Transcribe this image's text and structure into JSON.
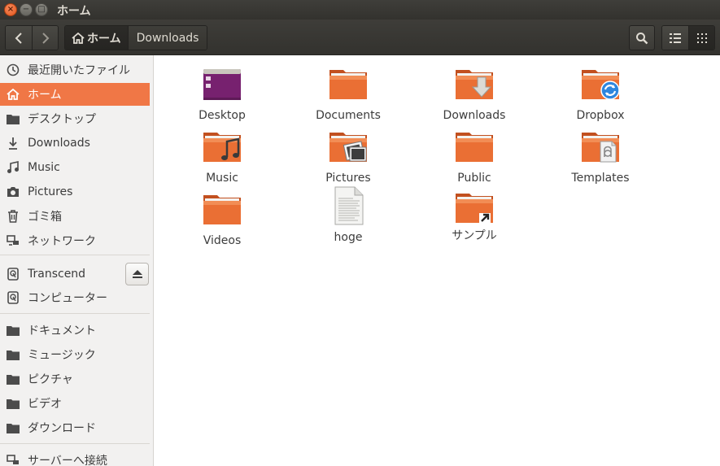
{
  "window": {
    "title": "ホーム"
  },
  "toolbar": {
    "breadcrumbs": [
      {
        "label": "ホーム",
        "active": true
      },
      {
        "label": "Downloads",
        "active": false
      }
    ]
  },
  "sidebar": {
    "items": [
      {
        "label": "最近開いたファイル",
        "icon": "clock-icon"
      },
      {
        "label": "ホーム",
        "icon": "home-icon",
        "active": true
      },
      {
        "label": "デスクトップ",
        "icon": "folder-icon"
      },
      {
        "label": "Downloads",
        "icon": "download-icon"
      },
      {
        "label": "Music",
        "icon": "music-icon"
      },
      {
        "label": "Pictures",
        "icon": "camera-icon"
      },
      {
        "label": "ゴミ箱",
        "icon": "trash-icon"
      },
      {
        "label": "ネットワーク",
        "icon": "network-icon"
      },
      {
        "label": "Transcend",
        "icon": "drive-icon"
      },
      {
        "label": "コンピューター",
        "icon": "drive-icon"
      },
      {
        "label": "ドキュメント",
        "icon": "folder-icon"
      },
      {
        "label": "ミュージック",
        "icon": "folder-icon"
      },
      {
        "label": "ピクチャ",
        "icon": "folder-icon"
      },
      {
        "label": "ビデオ",
        "icon": "folder-icon"
      },
      {
        "label": "ダウンロード",
        "icon": "folder-icon"
      },
      {
        "label": "サーバーへ接続",
        "icon": "server-icon"
      }
    ]
  },
  "files": [
    {
      "name": "Desktop",
      "type": "desktop"
    },
    {
      "name": "Documents",
      "type": "folder"
    },
    {
      "name": "Downloads",
      "type": "folder-download"
    },
    {
      "name": "Dropbox",
      "type": "folder-dropbox"
    },
    {
      "name": "Music",
      "type": "folder-music"
    },
    {
      "name": "Pictures",
      "type": "folder-pictures"
    },
    {
      "name": "Public",
      "type": "folder"
    },
    {
      "name": "Templates",
      "type": "folder-templates"
    },
    {
      "name": "Videos",
      "type": "folder"
    },
    {
      "name": "hoge",
      "type": "text-file"
    },
    {
      "name": "サンプル",
      "type": "folder-link"
    }
  ],
  "colors": {
    "accent": "#f07746",
    "folder": "#e9713a",
    "titlebar": "#3c3b37"
  }
}
